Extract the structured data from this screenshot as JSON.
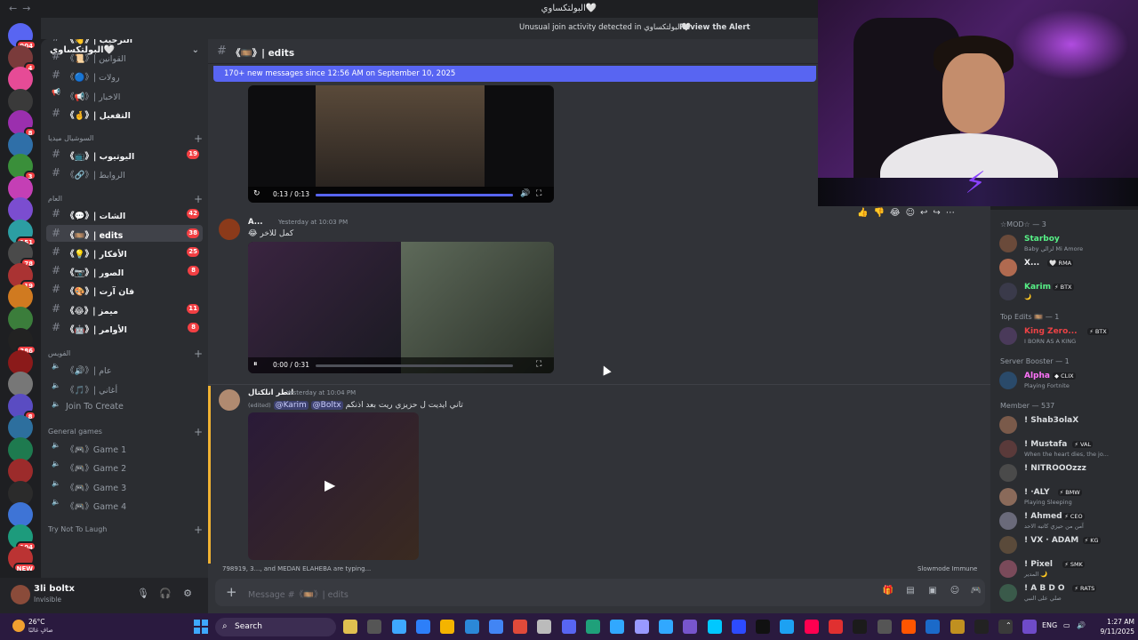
{
  "window": {
    "title": "البولتكساوي🤍"
  },
  "alert": {
    "text": "Unusual join activity detected in البولتكساوي🤍",
    "action": "Review the Alert"
  },
  "server_rail": {
    "badges": [
      "904",
      "4",
      "8",
      "3",
      "151",
      "78",
      "19",
      "386",
      "8",
      "104",
      "NEW"
    ],
    "colors": [
      "#5865f2",
      "#7a3b3b",
      "#e64b96",
      "#3a3a3a",
      "#9b2fae",
      "#2f6fa8",
      "#3a8f3a",
      "#c43fb5",
      "#7b4dd0",
      "#2c9ea3",
      "#4a4a4a",
      "#a33",
      "#d07a20",
      "#3b7d3b",
      "#222",
      "#8b1a1a",
      "#777",
      "#5a4cc2",
      "#2d6f9e",
      "#1e7a4f",
      "#9c2b2b",
      "#2b2b2b",
      "#3e74d6",
      "#1d9b7c",
      "#b33"
    ]
  },
  "guild": {
    "name": "البولتكساوي🤍"
  },
  "channels": [
    {
      "label": "《👋》| الترحيب",
      "type": "text",
      "state": "unread",
      "badge": ""
    },
    {
      "label": "《📜》| القوانين",
      "type": "text",
      "state": "muted",
      "badge": ""
    },
    {
      "label": "《🔵》| رولات",
      "type": "text",
      "state": "muted",
      "badge": ""
    },
    {
      "label": "《📢》| الاخبار",
      "type": "announce",
      "state": "muted",
      "badge": ""
    },
    {
      "label": "《🤞》| التفعيل",
      "type": "text",
      "state": "unread",
      "badge": ""
    },
    {
      "label": "《📺》| اليوتيوب",
      "type": "text",
      "state": "unread",
      "badge": "19"
    },
    {
      "label": "《🔗》| الروابط",
      "type": "text",
      "state": "muted",
      "badge": ""
    },
    {
      "label": "《💬》| الشات",
      "type": "text",
      "state": "unread",
      "badge": "42"
    },
    {
      "label": "《🎞️》| edits",
      "type": "text",
      "state": "active",
      "badge": "38"
    },
    {
      "label": "《💡》| الأفكار",
      "type": "text",
      "state": "unread",
      "badge": "25"
    },
    {
      "label": "《📷》| الصور",
      "type": "text",
      "state": "unread",
      "badge": "8"
    },
    {
      "label": "《🎨》| فان آرت",
      "type": "text",
      "state": "unread",
      "badge": ""
    },
    {
      "label": "《😂》| ميمز",
      "type": "text",
      "state": "unread",
      "badge": "11"
    },
    {
      "label": "《🤖》| الأوامر",
      "type": "text",
      "state": "unread",
      "badge": "8"
    },
    {
      "label": "《🔊》| عام",
      "type": "voice",
      "state": "muted",
      "badge": ""
    },
    {
      "label": "《🎵》| أغاني",
      "type": "voice",
      "state": "muted",
      "badge": ""
    },
    {
      "label": "Join To Create",
      "type": "voice",
      "state": "normal",
      "badge": ""
    },
    {
      "label": "《🎮》Game 1",
      "type": "voice",
      "state": "normal",
      "badge": ""
    },
    {
      "label": "《🎮》Game 2",
      "type": "voice",
      "state": "normal",
      "badge": ""
    },
    {
      "label": "《🎮》Game 3",
      "type": "voice",
      "state": "normal",
      "badge": ""
    },
    {
      "label": "《🎮》Game 4",
      "type": "voice",
      "state": "normal",
      "badge": ""
    }
  ],
  "categories": [
    "السوشيال ميديا",
    "العام",
    "الفويس",
    "General games",
    "Try Not To Laugh"
  ],
  "user": {
    "name": "3li boltx",
    "status": "Invisible"
  },
  "channel_header": {
    "name": "《🎞️》| edits"
  },
  "new_messages": {
    "text": "170+ new messages since 12:56 AM on September 10, 2025"
  },
  "messages": [
    {
      "video_time": "0:13 / 0:13",
      "progress": 1.0
    },
    {
      "author": "A...",
      "time": "Yesterday at 10:03 PM",
      "text": "😂 كمل للاخر",
      "video_time": "0:00 / 0:31",
      "progress": 0.0
    },
    {
      "author": "انطر انلكتال",
      "time": "Yesterday at 10:04 PM",
      "edited": "(edited)",
      "mention1": "@Karim",
      "mention2": "@Boltx",
      "text": "تاني ايديت ل حزيزي ريت بعد اذنكم"
    }
  ],
  "typing": {
    "text": "798919, 3..., and MEDAN ELAHEBA are typing..."
  },
  "slowmode": {
    "text": "Slowmode Immune"
  },
  "composer": {
    "placeholder": "Message #《🎞️》| edits"
  },
  "members": {
    "groups": [
      {
        "label": "☆MOD☆ — 3",
        "items": [
          {
            "name": "Starboy",
            "activity": "Baby لزالي Mi Amore",
            "color": "#57f287",
            "tag": ""
          },
          {
            "name": "X...",
            "activity": "",
            "color": "#f2f3f5",
            "tag": "🤍 RMA"
          },
          {
            "name": "Karim",
            "activity": "🌙",
            "color": "#57f287",
            "tag": "⚡ BTX"
          }
        ]
      },
      {
        "label": "Top Edits 🎞️ — 1",
        "items": [
          {
            "name": "King Zero...",
            "activity": "I BORN AS A KING",
            "color": "#ed4245",
            "tag": "⚡ BTX"
          }
        ]
      },
      {
        "label": "Server Booster — 1",
        "items": [
          {
            "name": "Alpha",
            "activity": "Playing Fortnite",
            "color": "#ff73fa",
            "tag": "◆ CLIX"
          }
        ]
      },
      {
        "label": "Member — 537",
        "items": [
          {
            "name": "! Shab3olaX",
            "activity": "",
            "color": "#dbdee1",
            "tag": ""
          },
          {
            "name": "! Mustafa",
            "activity": "When the heart dies, the jo...",
            "color": "#dbdee1",
            "tag": "⚡ VAL"
          },
          {
            "name": "! NITROOOzzz",
            "activity": "",
            "color": "#dbdee1",
            "tag": ""
          },
          {
            "name": "! ·ALY",
            "activity": "Playing Sleeping",
            "color": "#dbdee1",
            "tag": "⚡ BMW"
          },
          {
            "name": "! Ahmed",
            "activity": "آمن من حيزي كاتبه الاحد",
            "color": "#dbdee1",
            "tag": "⚡ CEO"
          },
          {
            "name": "! VX · ADAM",
            "activity": "",
            "color": "#dbdee1",
            "tag": "⚡ KG"
          },
          {
            "name": "! Pixel",
            "activity": "المدير 🌙",
            "color": "#dbdee1",
            "tag": "⚡ SMK"
          },
          {
            "name": "! A B D O",
            "activity": "صلي على النبي",
            "color": "#dbdee1",
            "tag": "⚡ RATS"
          }
        ]
      }
    ]
  },
  "taskbar": {
    "weather_temp": "26°C",
    "weather_desc": "صافٍ غالبًا",
    "search": "Search",
    "lang": "ENG",
    "time": "1:27 AM",
    "date": "9/11/2025",
    "apps": [
      "#e0c050",
      "#555",
      "#3ea8ff",
      "#2d7ff9",
      "#f4b400",
      "#2b88d8",
      "#4285f4",
      "#e04a3a",
      "#bbbbbb",
      "#5865f2",
      "#1fa07a",
      "#31a8ff",
      "#9999ff",
      "#31a8ff",
      "#7755cc",
      "#00c8ff",
      "#2d4bff",
      "#111",
      "#1da1f2",
      "#ff0050",
      "#e03030",
      "#1b1b1b",
      "#555",
      "#ff5500",
      "#1b6ac9",
      "#c09020",
      "#222",
      "#3a3a3a",
      "#6f4bc8"
    ]
  }
}
